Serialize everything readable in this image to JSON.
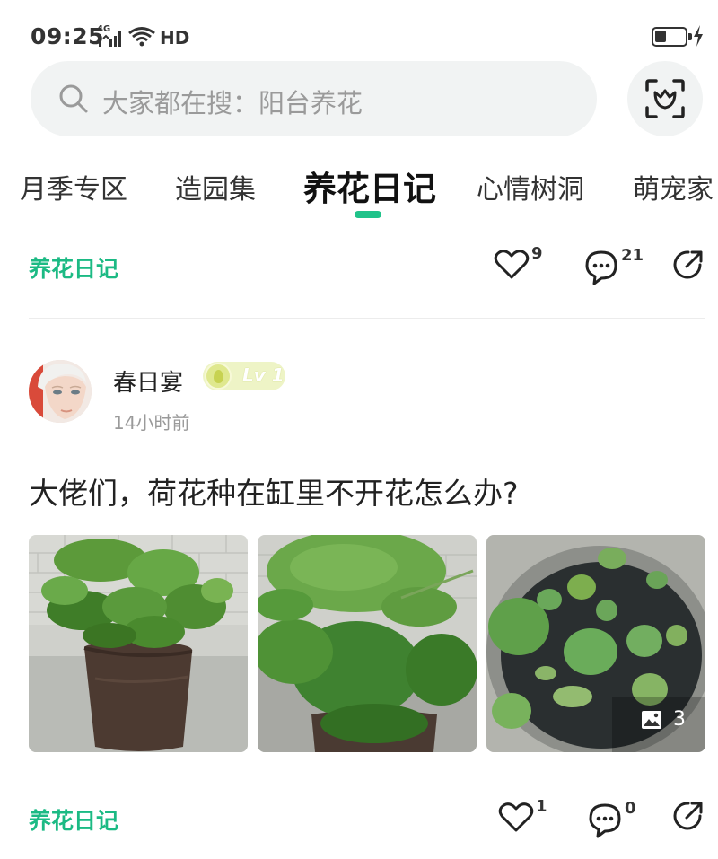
{
  "status_bar": {
    "time": "09:25",
    "network": "4G",
    "hd": "HD",
    "battery_level": 0.4
  },
  "search": {
    "placeholder": "大家都在搜：阳台养花"
  },
  "tabs": [
    {
      "label": "月季专区",
      "active": false
    },
    {
      "label": "造园集",
      "active": false
    },
    {
      "label": "养花日记",
      "active": true
    },
    {
      "label": "心情树洞",
      "active": false
    },
    {
      "label": "萌宠家",
      "active": false
    }
  ],
  "prev_post": {
    "category": "养花日记",
    "likes": "9",
    "comments": "21"
  },
  "post": {
    "author": "春日宴",
    "level": "Lv 1",
    "time": "14小时前",
    "title": "大佬们，荷花种在缸里不开花怎么办?",
    "image_count": "3",
    "category": "养花日记",
    "likes": "1",
    "comments": "0"
  },
  "colors": {
    "accent": "#1cba84",
    "search_bg": "#f1f3f3"
  }
}
